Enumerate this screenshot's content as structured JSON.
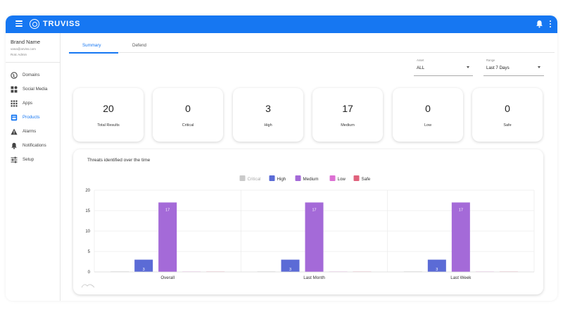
{
  "app": {
    "logo_text": "TRUVISS"
  },
  "topbar": {
    "menu_icon": "hamburger-icon",
    "notification_icon": "bell-icon",
    "more_icon": "kebab-icon"
  },
  "sidebar": {
    "brand_name": "Brand Name",
    "email": "vana@arviss.com",
    "role": "Rotc Admin",
    "items": [
      {
        "label": "Domains",
        "icon": "globe-icon"
      },
      {
        "label": "Social Media",
        "icon": "social-media-icon"
      },
      {
        "label": "Apps",
        "icon": "apps-grid-icon"
      },
      {
        "label": "Products",
        "icon": "products-icon",
        "active": true
      },
      {
        "label": "Alarms",
        "icon": "warning-icon"
      },
      {
        "label": "Notifications",
        "icon": "bell-icon"
      },
      {
        "label": "Setup",
        "icon": "sliders-icon"
      }
    ]
  },
  "tabs": [
    {
      "label": "Summary",
      "active": true
    },
    {
      "label": "Defend",
      "active": false
    }
  ],
  "filters": {
    "asset": {
      "label": "Asset",
      "value": "ALL"
    },
    "range": {
      "label": "Range",
      "value": "Last 7 Days"
    }
  },
  "stats": [
    {
      "value": "20",
      "label": "Total Results"
    },
    {
      "value": "0",
      "label": "Critical"
    },
    {
      "value": "3",
      "label": "High"
    },
    {
      "value": "17",
      "label": "Medium"
    },
    {
      "value": "0",
      "label": "Low"
    },
    {
      "value": "0",
      "label": "Safe"
    }
  ],
  "colors": {
    "accent": "#1677f2",
    "critical": "#9e9e9e",
    "high": "#5b6bd6",
    "medium": "#a46ad8",
    "low": "#dc70d3",
    "safe": "#e0627c"
  },
  "chart_data": {
    "type": "bar",
    "title": "Threats identified over the time",
    "categories": [
      "Overall",
      "Last Month",
      "Last Week"
    ],
    "series": [
      {
        "name": "Critical",
        "color": "#9e9e9e",
        "values": [
          0,
          0,
          0
        ],
        "legend_dimmed": true
      },
      {
        "name": "High",
        "color": "#5b6bd6",
        "values": [
          3,
          3,
          3
        ]
      },
      {
        "name": "Medium",
        "color": "#a46ad8",
        "values": [
          17,
          17,
          17
        ]
      },
      {
        "name": "Low",
        "color": "#dc70d3",
        "values": [
          0,
          0,
          0
        ]
      },
      {
        "name": "Safe",
        "color": "#e0627c",
        "values": [
          0,
          0,
          0
        ]
      }
    ],
    "y_ticks": [
      0,
      5,
      10,
      15,
      20
    ],
    "ylim": [
      0,
      20
    ],
    "grid": true,
    "legend_position": "top-center"
  }
}
